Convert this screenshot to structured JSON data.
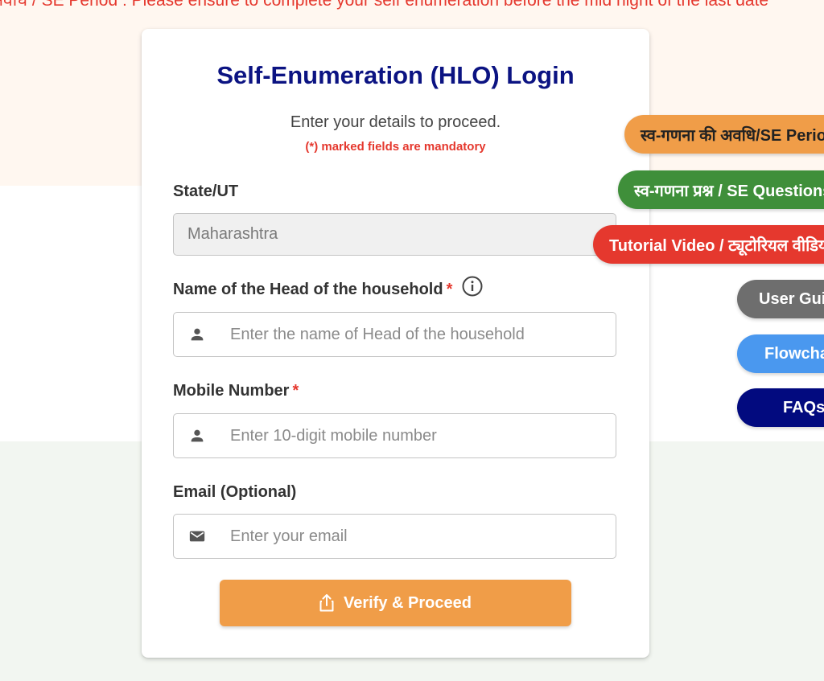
{
  "marquee": {
    "text": "अवधि / SE Period : Please ensure to complete your self enumeration before the mid night of the last date"
  },
  "login": {
    "title": "Self-Enumeration (HLO) Login",
    "subtitle": "Enter your details to proceed.",
    "mandatory_note": "(*) marked fields are mandatory",
    "state": {
      "label": "State/UT",
      "value": "Maharashtra"
    },
    "head_name": {
      "label": "Name of the Head of the household",
      "required_mark": "*",
      "placeholder": "Enter the name of Head of the household",
      "icon": "person-icon",
      "info_icon": "info-icon"
    },
    "mobile": {
      "label": "Mobile Number",
      "required_mark": "*",
      "placeholder": "Enter 10-digit mobile number",
      "icon": "person-icon"
    },
    "email": {
      "label": "Email (Optional)",
      "placeholder": "Enter your email",
      "icon": "mail-icon"
    },
    "verify_button": {
      "label": "Verify & Proceed",
      "icon": "share-icon"
    }
  },
  "side_menu": {
    "period": "स्व-गणना की अवधि/SE Period",
    "questions": "स्व-गणना प्रश्न / SE Questions",
    "tutorial": "Tutorial Video / ट्यूटोरियल वीडियो",
    "user_guide": "User Guide",
    "flowchart": "Flowchart",
    "faqs": "FAQs"
  },
  "colors": {
    "title_navy": "#0b1382",
    "accent_orange": "#f09d48",
    "danger_red": "#e5382e",
    "green": "#3f8f3a",
    "grey": "#6e6e6e",
    "blue": "#4a98ef",
    "navy": "#020a7f"
  }
}
